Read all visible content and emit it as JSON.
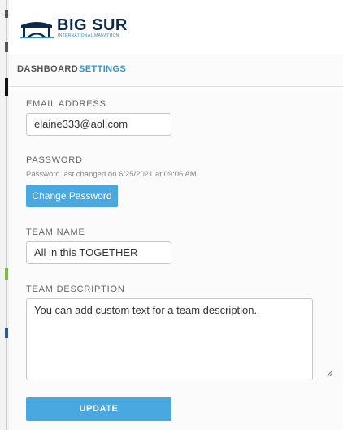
{
  "header": {
    "brand": "BIG SUR",
    "brand_sub": "INTERNATIONAL MARATHON",
    "logo_icon": "bridge-icon"
  },
  "nav": {
    "tabs": [
      {
        "label": "DASHBOARD",
        "active": false
      },
      {
        "label": "SETTINGS",
        "active": true
      }
    ]
  },
  "form": {
    "email": {
      "label": "EMAIL ADDRESS",
      "value": "elaine333@aol.com"
    },
    "password": {
      "label": "PASSWORD",
      "hint": "Password last changed on 6/25/2021 at 09:06 AM",
      "button": "Change Password"
    },
    "team_name": {
      "label": "TEAM NAME",
      "value": "All in this TOGETHER"
    },
    "team_description": {
      "label": "TEAM DESCRIPTION",
      "value": "You can add custom text for a team description."
    },
    "submit": "UPDATE"
  },
  "colors": {
    "accent": "#2f95d6",
    "button": "#4aa8e0",
    "brand_navy": "#0e2a47"
  }
}
